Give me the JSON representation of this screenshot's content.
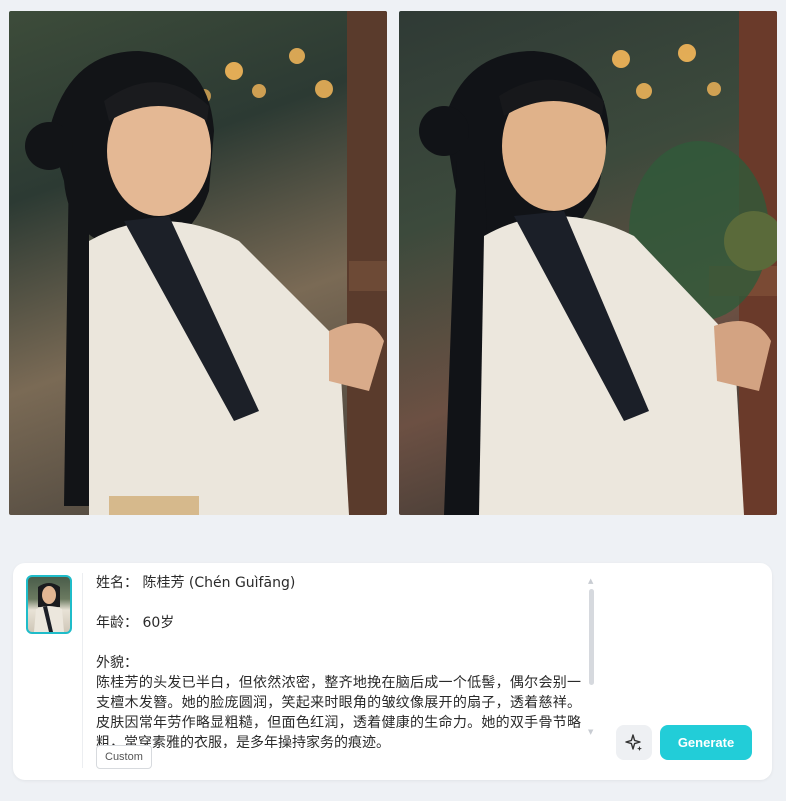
{
  "images": {
    "left_alt": "Elderly woman in white hanfu, portrait 1",
    "right_alt": "Elderly woman in white hanfu, portrait 2"
  },
  "prompt": {
    "lines": [
      "姓名： 陈桂芳 (Chén Guìfāng)",
      "",
      "年龄： 60岁",
      "",
      "外貌："
    ],
    "paragraph": "陈桂芳的头发已半白，但依然浓密，整齐地挽在脑后成一个低髻，偶尔会别一支檀木发簪。她的脸庞圆润，笑起来时眼角的皱纹像展开的扇子，透着慈祥。皮肤因常年劳作略显粗糙，但面色红润，透着健康的生命力。她的双手骨节略粗，常穿素雅的衣服，是多年操持家务的痕迹。"
  },
  "buttons": {
    "custom": "Custom",
    "generate": "Generate"
  },
  "icons": {
    "magic": "sparkle-icon",
    "scroll_up": "chevron-up-icon",
    "scroll_down": "chevron-down-icon"
  },
  "colors": {
    "accent": "#22cdd8",
    "avatar_border": "#1fbcc9"
  }
}
